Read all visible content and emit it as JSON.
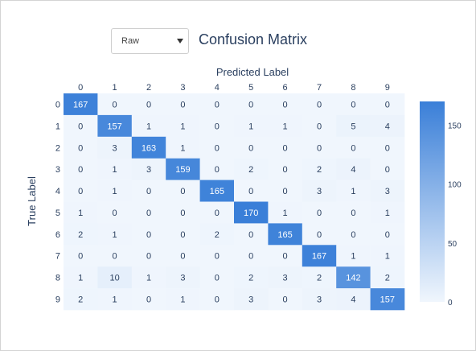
{
  "controls": {
    "mode_select": {
      "value": "Raw"
    }
  },
  "chart_data": {
    "type": "heatmap",
    "title": "Confusion Matrix",
    "xlabel": "Predicted Label",
    "ylabel": "True Label",
    "x_categories": [
      "0",
      "1",
      "2",
      "3",
      "4",
      "5",
      "6",
      "7",
      "8",
      "9"
    ],
    "y_categories": [
      "0",
      "1",
      "2",
      "3",
      "4",
      "5",
      "6",
      "7",
      "8",
      "9"
    ],
    "values": [
      [
        167,
        0,
        0,
        0,
        0,
        0,
        0,
        0,
        0,
        0
      ],
      [
        0,
        157,
        1,
        1,
        0,
        1,
        1,
        0,
        5,
        4
      ],
      [
        0,
        3,
        163,
        1,
        0,
        0,
        0,
        0,
        0,
        0
      ],
      [
        0,
        1,
        3,
        159,
        0,
        2,
        0,
        2,
        4,
        0
      ],
      [
        0,
        1,
        0,
        0,
        165,
        0,
        0,
        3,
        1,
        3
      ],
      [
        1,
        0,
        0,
        0,
        0,
        170,
        1,
        0,
        0,
        1
      ],
      [
        2,
        1,
        0,
        0,
        2,
        0,
        165,
        0,
        0,
        0
      ],
      [
        0,
        0,
        0,
        0,
        0,
        0,
        0,
        167,
        1,
        1
      ],
      [
        1,
        10,
        1,
        3,
        0,
        2,
        3,
        2,
        142,
        2
      ],
      [
        2,
        1,
        0,
        1,
        0,
        3,
        0,
        3,
        4,
        157
      ]
    ],
    "colorscale": [
      "#f0f6fd",
      "#3a7fd8"
    ],
    "zmin": 0,
    "zmax": 170,
    "x_axis_position": "top",
    "colorbar": {
      "tick_values": [
        0,
        50,
        100,
        150
      ],
      "tick_labels": [
        "0",
        "50",
        "100",
        "150"
      ]
    }
  }
}
